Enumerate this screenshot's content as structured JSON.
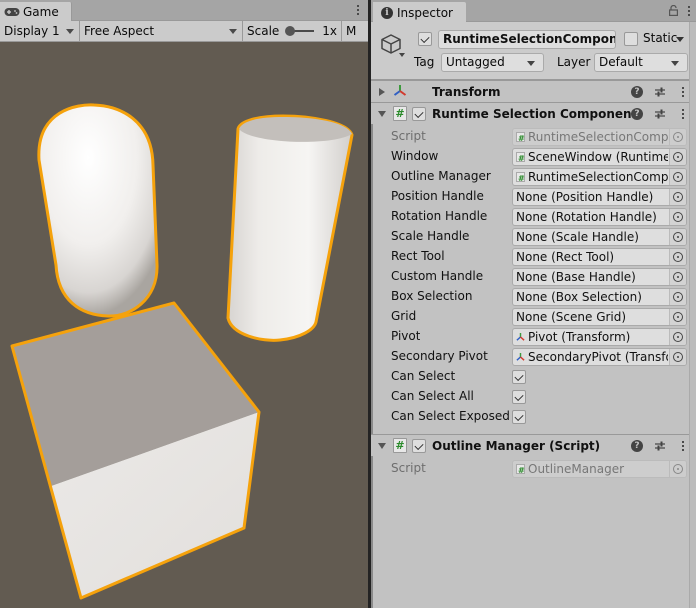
{
  "game": {
    "tab_label": "Game",
    "tab_icon": "gamepad-icon",
    "toolbar": {
      "display": "Display 1",
      "aspect": "Free Aspect",
      "scale_label": "Scale",
      "scale_value": "1x",
      "overflow_label": "M"
    },
    "scene": {
      "background_color": "#625b51",
      "outline_color": "#f5a20c",
      "objects": [
        "Capsule",
        "Cylinder",
        "Cube"
      ]
    }
  },
  "inspector": {
    "tab_label": "Inspector",
    "object": {
      "active": true,
      "name": "RuntimeSelectionComponent",
      "static": false,
      "static_label": "Static",
      "tag_label": "Tag",
      "tag_value": "Untagged",
      "layer_label": "Layer",
      "layer_value": "Default"
    },
    "components": [
      {
        "title": "Transform",
        "expanded": false,
        "icon": "transform-icon"
      },
      {
        "title": "Runtime Selection Component (Script)",
        "expanded": true,
        "enabled": true,
        "icon": "script-icon",
        "properties": [
          {
            "label": "Script",
            "type": "object",
            "value": "RuntimeSelectionComponent",
            "icon": "script",
            "disabled": true
          },
          {
            "label": "Window",
            "type": "object",
            "value": "SceneWindow (Runtime Window)",
            "icon": "script"
          },
          {
            "label": "Outline Manager",
            "type": "object",
            "value": "RuntimeSelectionComponent",
            "icon": "script"
          },
          {
            "label": "Position Handle",
            "type": "object",
            "value": "None (Position Handle)"
          },
          {
            "label": "Rotation Handle",
            "type": "object",
            "value": "None (Rotation Handle)"
          },
          {
            "label": "Scale Handle",
            "type": "object",
            "value": "None (Scale Handle)"
          },
          {
            "label": "Rect Tool",
            "type": "object",
            "value": "None (Rect Tool)"
          },
          {
            "label": "Custom Handle",
            "type": "object",
            "value": "None (Base Handle)"
          },
          {
            "label": "Box Selection",
            "type": "object",
            "value": "None (Box Selection)"
          },
          {
            "label": "Grid",
            "type": "object",
            "value": "None (Scene Grid)"
          },
          {
            "label": "Pivot",
            "type": "object",
            "value": "Pivot (Transform)",
            "icon": "transform"
          },
          {
            "label": "Secondary Pivot",
            "type": "object",
            "value": "SecondaryPivot (Transform)",
            "icon": "transform"
          },
          {
            "label": "Can Select",
            "type": "bool",
            "value": true
          },
          {
            "label": "Can Select All",
            "type": "bool",
            "value": true
          },
          {
            "label": "Can Select Exposed Objects",
            "type": "bool",
            "value": true
          }
        ]
      },
      {
        "title": "Outline Manager (Script)",
        "expanded": true,
        "enabled": true,
        "icon": "script-icon",
        "properties": [
          {
            "label": "Script",
            "type": "object",
            "value": "OutlineManager",
            "icon": "script",
            "disabled": true
          }
        ]
      }
    ]
  }
}
